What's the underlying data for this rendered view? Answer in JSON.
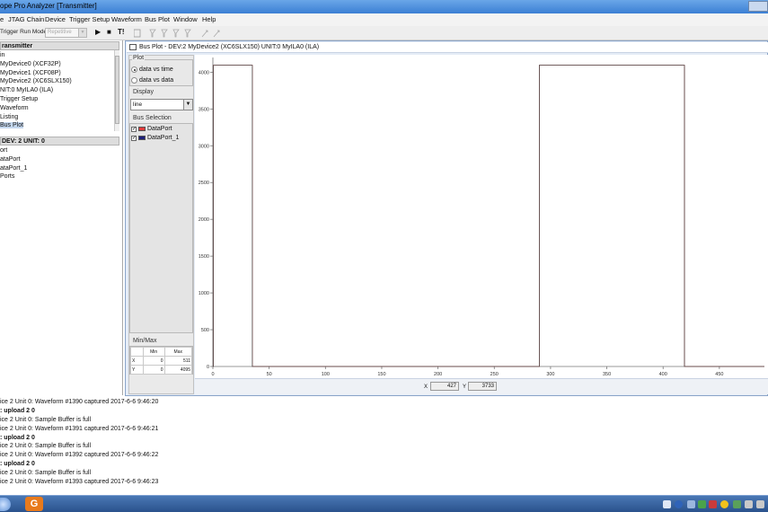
{
  "window": {
    "title": "ope Pro Analyzer [Transmitter]"
  },
  "menu": [
    "e",
    "JTAG Chain",
    "Device",
    "Trigger Setup",
    "Waveform",
    "Bus Plot",
    "Window",
    "Help"
  ],
  "toolbar": {
    "trigger_run_mode_label": "Trigger Run Mode:",
    "mode_value": "Repetitive",
    "dropdown_arrow": "▼",
    "run": "▶",
    "stop": "■",
    "trigger_now": "T!"
  },
  "project": {
    "header": "ransmitter",
    "items": [
      "in",
      "MyDevice0 (XCF32P)",
      "MyDevice1 (XCF08P)",
      "MyDevice2 (XC6SLX150)",
      "NIT:0 MyILA0 (ILA)",
      "Trigger Setup",
      "Waveform",
      "Listing",
      "Bus Plot"
    ]
  },
  "signals": {
    "header": "DEV: 2 UNIT: 0",
    "items": [
      "ort",
      "ataPort",
      "ataPort_1",
      "Ports"
    ]
  },
  "busplot": {
    "title": "Bus Plot - DEV:2 MyDevice2 (XC6SLX150) UNIT:0 MyILA0 (ILA)",
    "plot_group": "Plot",
    "plot_options": [
      {
        "label": "data vs time",
        "selected": true
      },
      {
        "label": "data vs data",
        "selected": false
      }
    ],
    "display_group": "Display",
    "display_value": "line",
    "display_arrow": "▼",
    "bus_selection_group": "Bus Selection",
    "buses": [
      {
        "name": "DataPort",
        "color": "#e03a3a",
        "checked": true
      },
      {
        "name": "DataPort_1",
        "color": "#1c1f7a",
        "checked": true
      }
    ],
    "minmax_group": "Min/Max",
    "minmax_headers": [
      "",
      "Min",
      "Max"
    ],
    "minmax_rows": [
      {
        "axis": "X",
        "min": "0",
        "max": "511"
      },
      {
        "axis": "Y",
        "min": "0",
        "max": "4095"
      }
    ],
    "status": {
      "x_label": "X",
      "x_value": "427",
      "y_label": "Y",
      "y_value": "3733"
    }
  },
  "chart_data": {
    "type": "line",
    "xlim": [
      0,
      490
    ],
    "ylim": [
      0,
      4200
    ],
    "xticks": [
      0,
      50,
      100,
      150,
      200,
      250,
      300,
      350,
      400,
      450
    ],
    "yticks": [
      0,
      500,
      1000,
      1500,
      2000,
      2500,
      3000,
      3500,
      4000
    ],
    "series": [
      {
        "name": "DataPort",
        "color": "#e03a3a",
        "x": [
          0,
          0.5,
          0.5,
          35,
          35,
          290,
          290,
          419,
          419,
          490
        ],
        "y": [
          0,
          0,
          4095,
          4095,
          0,
          0,
          4095,
          4095,
          0,
          0
        ]
      },
      {
        "name": "DataPort_1",
        "color": "#1c1f7a",
        "x": [
          0,
          0.5,
          0.5,
          35,
          35,
          290,
          290,
          419,
          419,
          490
        ],
        "y": [
          0,
          0,
          4095,
          4095,
          0,
          0,
          4095,
          4095,
          0,
          0
        ]
      }
    ]
  },
  "console": [
    {
      "text": "ice 2 Unit 0:  Waveform #1390 captured 2017-6-6 9:46:20",
      "bold": false
    },
    {
      "text": ": upload 2 0",
      "bold": true
    },
    {
      "text": "ice 2 Unit 0:  Sample Buffer is full",
      "bold": false
    },
    {
      "text": "ice 2 Unit 0:  Waveform #1391 captured 2017-6-6 9:46:21",
      "bold": false
    },
    {
      "text": ": upload 2 0",
      "bold": true
    },
    {
      "text": "ice 2 Unit 0:  Sample Buffer is full",
      "bold": false
    },
    {
      "text": "ice 2 Unit 0:  Waveform #1392 captured 2017-6-6 9:46:22",
      "bold": false
    },
    {
      "text": ": upload 2 0",
      "bold": true
    },
    {
      "text": "ice 2 Unit 0:  Sample Buffer is full",
      "bold": false
    },
    {
      "text": "ice 2 Unit 0:  Waveform #1393 captured 2017-6-6 9:46:23",
      "bold": false
    }
  ],
  "taskbar": {
    "app_icon_letter": "G"
  }
}
